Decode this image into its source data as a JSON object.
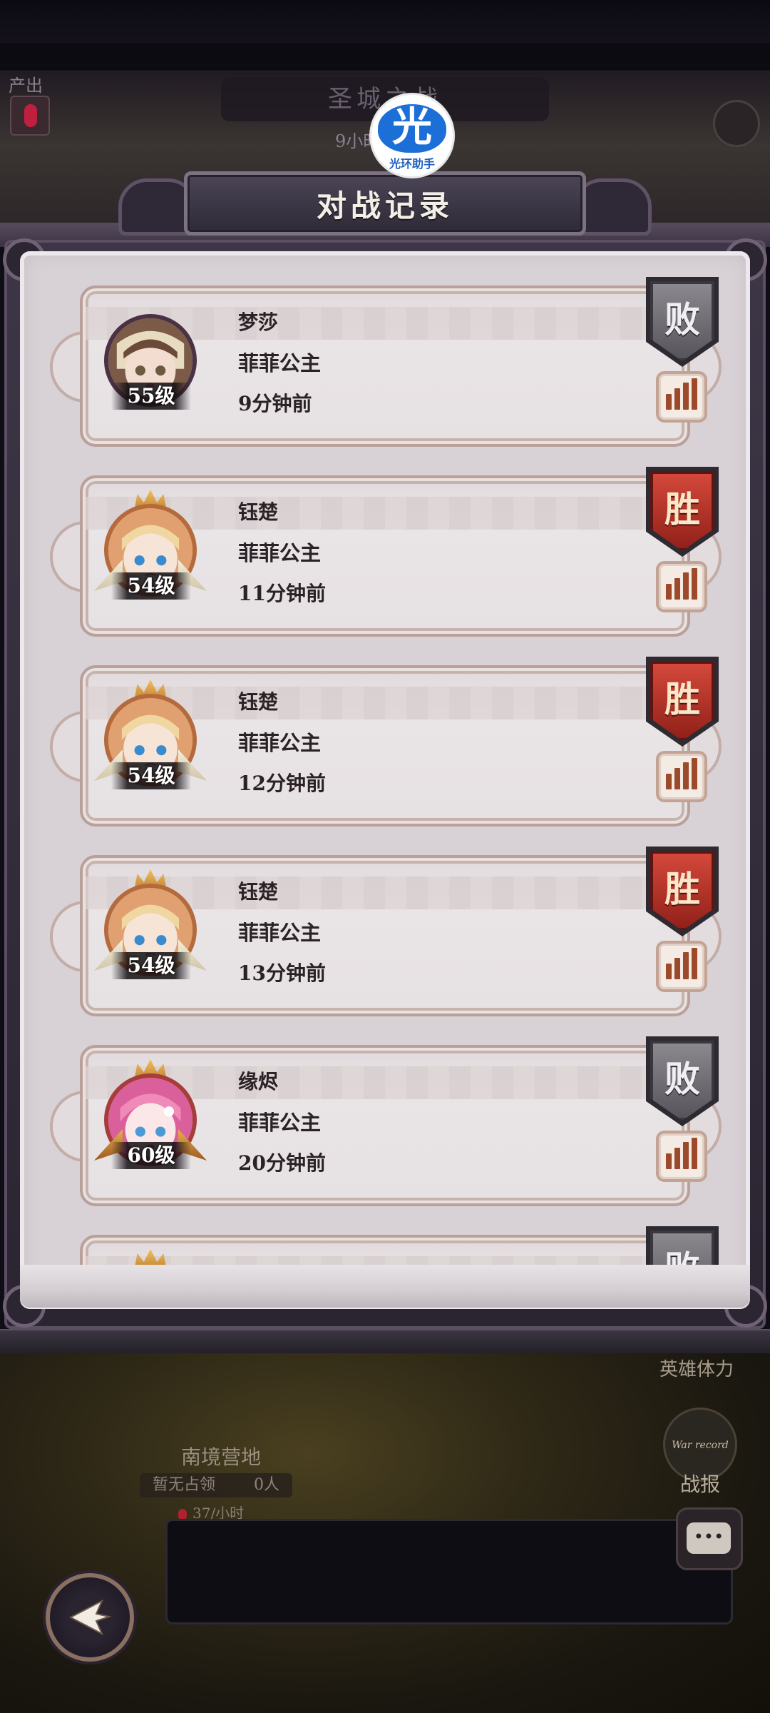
{
  "background": {
    "top_title": "圣城之战",
    "top_subtitle": "9小时",
    "output_label": "产出",
    "location_name": "南境营地",
    "occupy_status": "暂无占领",
    "occupy_count": "0人",
    "rate": "37/小时",
    "hero_stamina_label": "英雄体力",
    "war_record_icon_text": "War record",
    "war_record_label": "战报"
  },
  "watermark": {
    "logo_char": "光",
    "logo_text": "光环助手"
  },
  "dialog": {
    "title": "对战记录"
  },
  "records": [
    {
      "name": "梦莎",
      "server": "菲菲公主",
      "time": "9分钟前",
      "level": "55级",
      "result": "败",
      "result_type": "loss",
      "avatar": "brown-hair-girl-avatar"
    },
    {
      "name": "钰楚",
      "server": "菲菲公主",
      "time": "11分钟前",
      "level": "54级",
      "result": "胜",
      "result_type": "win",
      "avatar": "blonde-girl-avatar"
    },
    {
      "name": "钰楚",
      "server": "菲菲公主",
      "time": "12分钟前",
      "level": "54级",
      "result": "胜",
      "result_type": "win",
      "avatar": "blonde-girl-avatar"
    },
    {
      "name": "钰楚",
      "server": "菲菲公主",
      "time": "13分钟前",
      "level": "54级",
      "result": "胜",
      "result_type": "win",
      "avatar": "blonde-girl-avatar"
    },
    {
      "name": "缘烬",
      "server": "菲菲公主",
      "time": "20分钟前",
      "level": "60级",
      "result": "败",
      "result_type": "loss",
      "avatar": "pink-hair-girl-avatar"
    },
    {
      "name": "",
      "server": "",
      "time": "",
      "level": "",
      "result": "败",
      "result_type": "loss",
      "avatar": "partially-visible-avatar"
    }
  ],
  "colors": {
    "win_badge": "#b8322a",
    "loss_badge": "#6e6b72",
    "card_bg": "#e6e1e3",
    "panel_bg": "#d8d2d6"
  }
}
